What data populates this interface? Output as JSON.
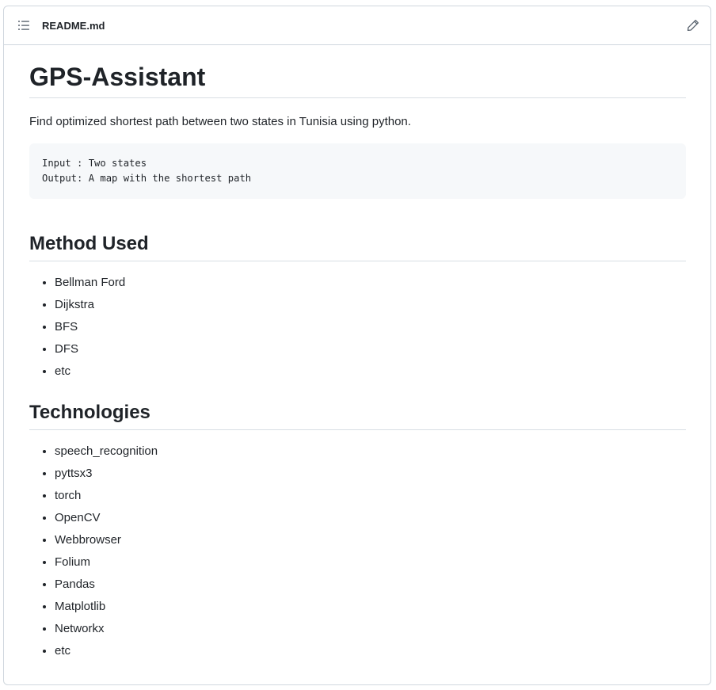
{
  "header": {
    "file_name": "README.md",
    "toc_icon": "list-unordered-icon",
    "edit_icon": "pencil-icon"
  },
  "readme": {
    "title": "GPS-Assistant",
    "description": "Find optimized shortest path between two states in Tunisia using python.",
    "code_lines": [
      "Input : Two states",
      "Output: A map with the shortest path"
    ],
    "methods_heading": "Method Used",
    "methods": [
      "Bellman Ford",
      "Dijkstra",
      "BFS",
      "DFS",
      "etc"
    ],
    "tech_heading": "Technologies",
    "technologies": [
      "speech_recognition",
      "pyttsx3",
      "torch",
      "OpenCV",
      "Webbrowser",
      "Folium",
      "Pandas",
      "Matplotlib",
      "Networkx",
      "etc"
    ]
  },
  "colors": {
    "border": "#d0d7de",
    "text": "#1f2328",
    "code_bg": "#f6f8fa"
  }
}
